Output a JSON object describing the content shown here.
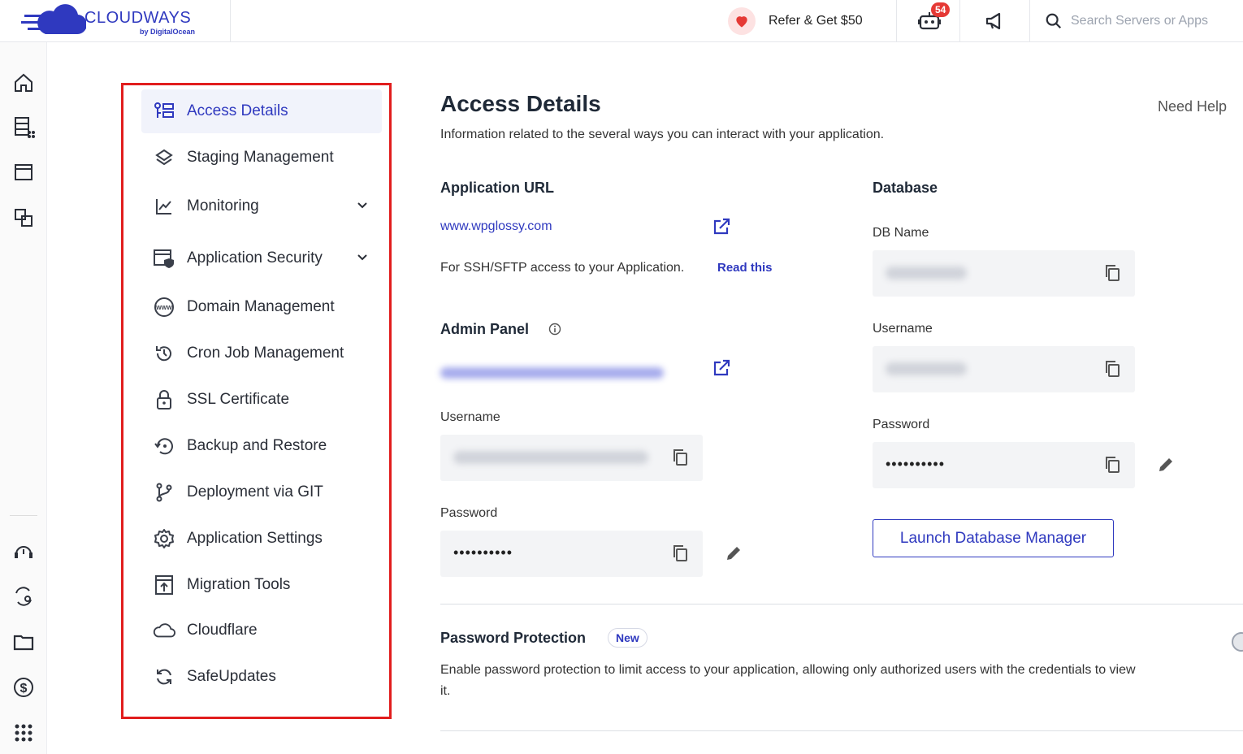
{
  "header": {
    "logo_text": "CLOUDWAYS",
    "logo_sub": "by DigitalOcean",
    "refer_label": "Refer & Get $50",
    "notification_count": "54",
    "search_placeholder": "Search Servers or Apps"
  },
  "left_rail": {
    "icons": [
      "home-icon",
      "servers-icon",
      "applications-icon",
      "projects-icon",
      "support-icon",
      "team-icon",
      "folder-icon",
      "billing-icon",
      "apps-grid-icon"
    ]
  },
  "app_nav": {
    "items": [
      {
        "label": "Access Details",
        "icon": "access-details-icon",
        "active": true
      },
      {
        "label": "Staging Management",
        "icon": "layers-icon"
      },
      {
        "label": "Monitoring",
        "icon": "chart-line-icon",
        "expandable": true
      },
      {
        "label": "Application Security",
        "icon": "shield-window-icon",
        "expandable": true
      },
      {
        "label": "Domain Management",
        "icon": "www-icon"
      },
      {
        "label": "Cron Job Management",
        "icon": "history-icon"
      },
      {
        "label": "SSL Certificate",
        "icon": "lock-icon"
      },
      {
        "label": "Backup and Restore",
        "icon": "backup-icon"
      },
      {
        "label": "Deployment via GIT",
        "icon": "git-branch-icon"
      },
      {
        "label": "Application Settings",
        "icon": "gear-icon"
      },
      {
        "label": "Migration Tools",
        "icon": "upload-box-icon"
      },
      {
        "label": "Cloudflare",
        "icon": "cloud-icon"
      },
      {
        "label": "SafeUpdates",
        "icon": "refresh-icon"
      }
    ]
  },
  "main": {
    "title": "Access Details",
    "need_help": "Need Help",
    "subtitle": "Information related to the several ways you can interact with your application.",
    "app_url": {
      "heading": "Application URL",
      "url": "www.wpglossy.com",
      "ssh_text": "For SSH/SFTP access to your Application.",
      "read_this": "Read this"
    },
    "admin_panel": {
      "heading": "Admin Panel",
      "username_label": "Username",
      "password_label": "Password",
      "password_value": "••••••••••"
    },
    "database": {
      "heading": "Database",
      "db_name_label": "DB Name",
      "username_label": "Username",
      "password_label": "Password",
      "password_value": "••••••••••",
      "launch_button": "Launch Database Manager"
    },
    "password_protection": {
      "heading": "Password Protection",
      "badge": "New",
      "description": "Enable password protection to limit access to your application, allowing only authorized users with the credentials to view it."
    }
  },
  "colors": {
    "accent": "#2f39bf",
    "highlight_border": "#e11d1d",
    "badge_red": "#e53935"
  }
}
